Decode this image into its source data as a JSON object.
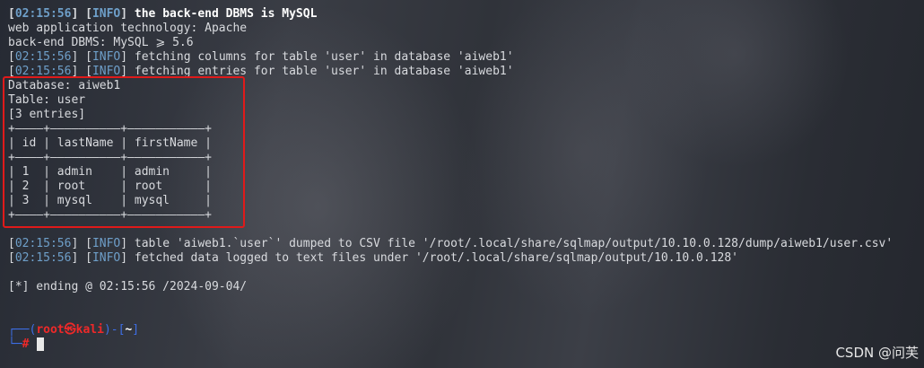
{
  "log": {
    "l1": {
      "ts": "02:15:56",
      "level": "INFO",
      "msg": " the back-end DBMS is MySQL"
    },
    "l2": "web application technology: Apache",
    "l3": "back-end DBMS: MySQL ⩾ 5.6",
    "l4": {
      "ts": "02:15:56",
      "level": "INFO",
      "msg": " fetching columns for table 'user' in database 'aiweb1'"
    },
    "l5": {
      "ts": "02:15:56",
      "level": "INFO",
      "msg": " fetching entries for table 'user' in database 'aiweb1'"
    }
  },
  "dump": {
    "database": "Database: aiweb1",
    "table": "Table: user",
    "entries": "[3 entries]",
    "border": "+————+——————————+———————————+",
    "header": "| id | lastName | firstName |",
    "rows": [
      "| 1  | admin    | admin     |",
      "| 2  | root     | root      |",
      "| 3  | mysql    | mysql     |"
    ]
  },
  "post": {
    "l1": {
      "ts": "02:15:56",
      "level": "INFO",
      "msg": " table 'aiweb1.`user`' dumped to CSV file '/root/.local/share/sqlmap/output/10.10.0.128/dump/aiweb1/user.csv'"
    },
    "l2": {
      "ts": "02:15:56",
      "level": "INFO",
      "msg": " fetched data logged to text files under '/root/.local/share/sqlmap/output/10.10.0.128'"
    },
    "ending": "[*] ending @ 02:15:56 /2024-09-04/"
  },
  "prompt": {
    "line1_prefix": "┌──(",
    "user_host": "root㉿kali",
    "line1_mid": ")-[",
    "dir": "~",
    "line1_end": "]",
    "line2_prefix": "└─",
    "symbol": "#"
  },
  "watermark": "CSDN @问芙"
}
